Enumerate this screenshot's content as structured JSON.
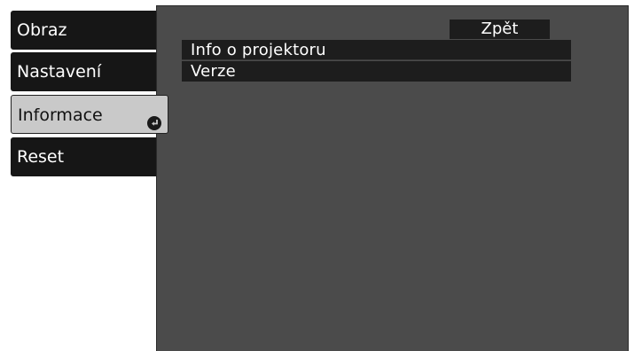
{
  "menu": {
    "items": [
      {
        "label": "Obraz"
      },
      {
        "label": "Nastavení"
      },
      {
        "label": "Informace"
      },
      {
        "label": "Reset"
      }
    ]
  },
  "panel": {
    "back_label": "Zpět",
    "items": [
      {
        "label": "Info o projektoru"
      },
      {
        "label": "Verze"
      }
    ]
  },
  "icons": {
    "enter": "enter-return-icon"
  },
  "colors": {
    "menu_bg": "#161616",
    "menu_selected_bg": "#c9c9c9",
    "panel_bg": "#4b4b4b",
    "item_bg": "#1d1d1d"
  }
}
